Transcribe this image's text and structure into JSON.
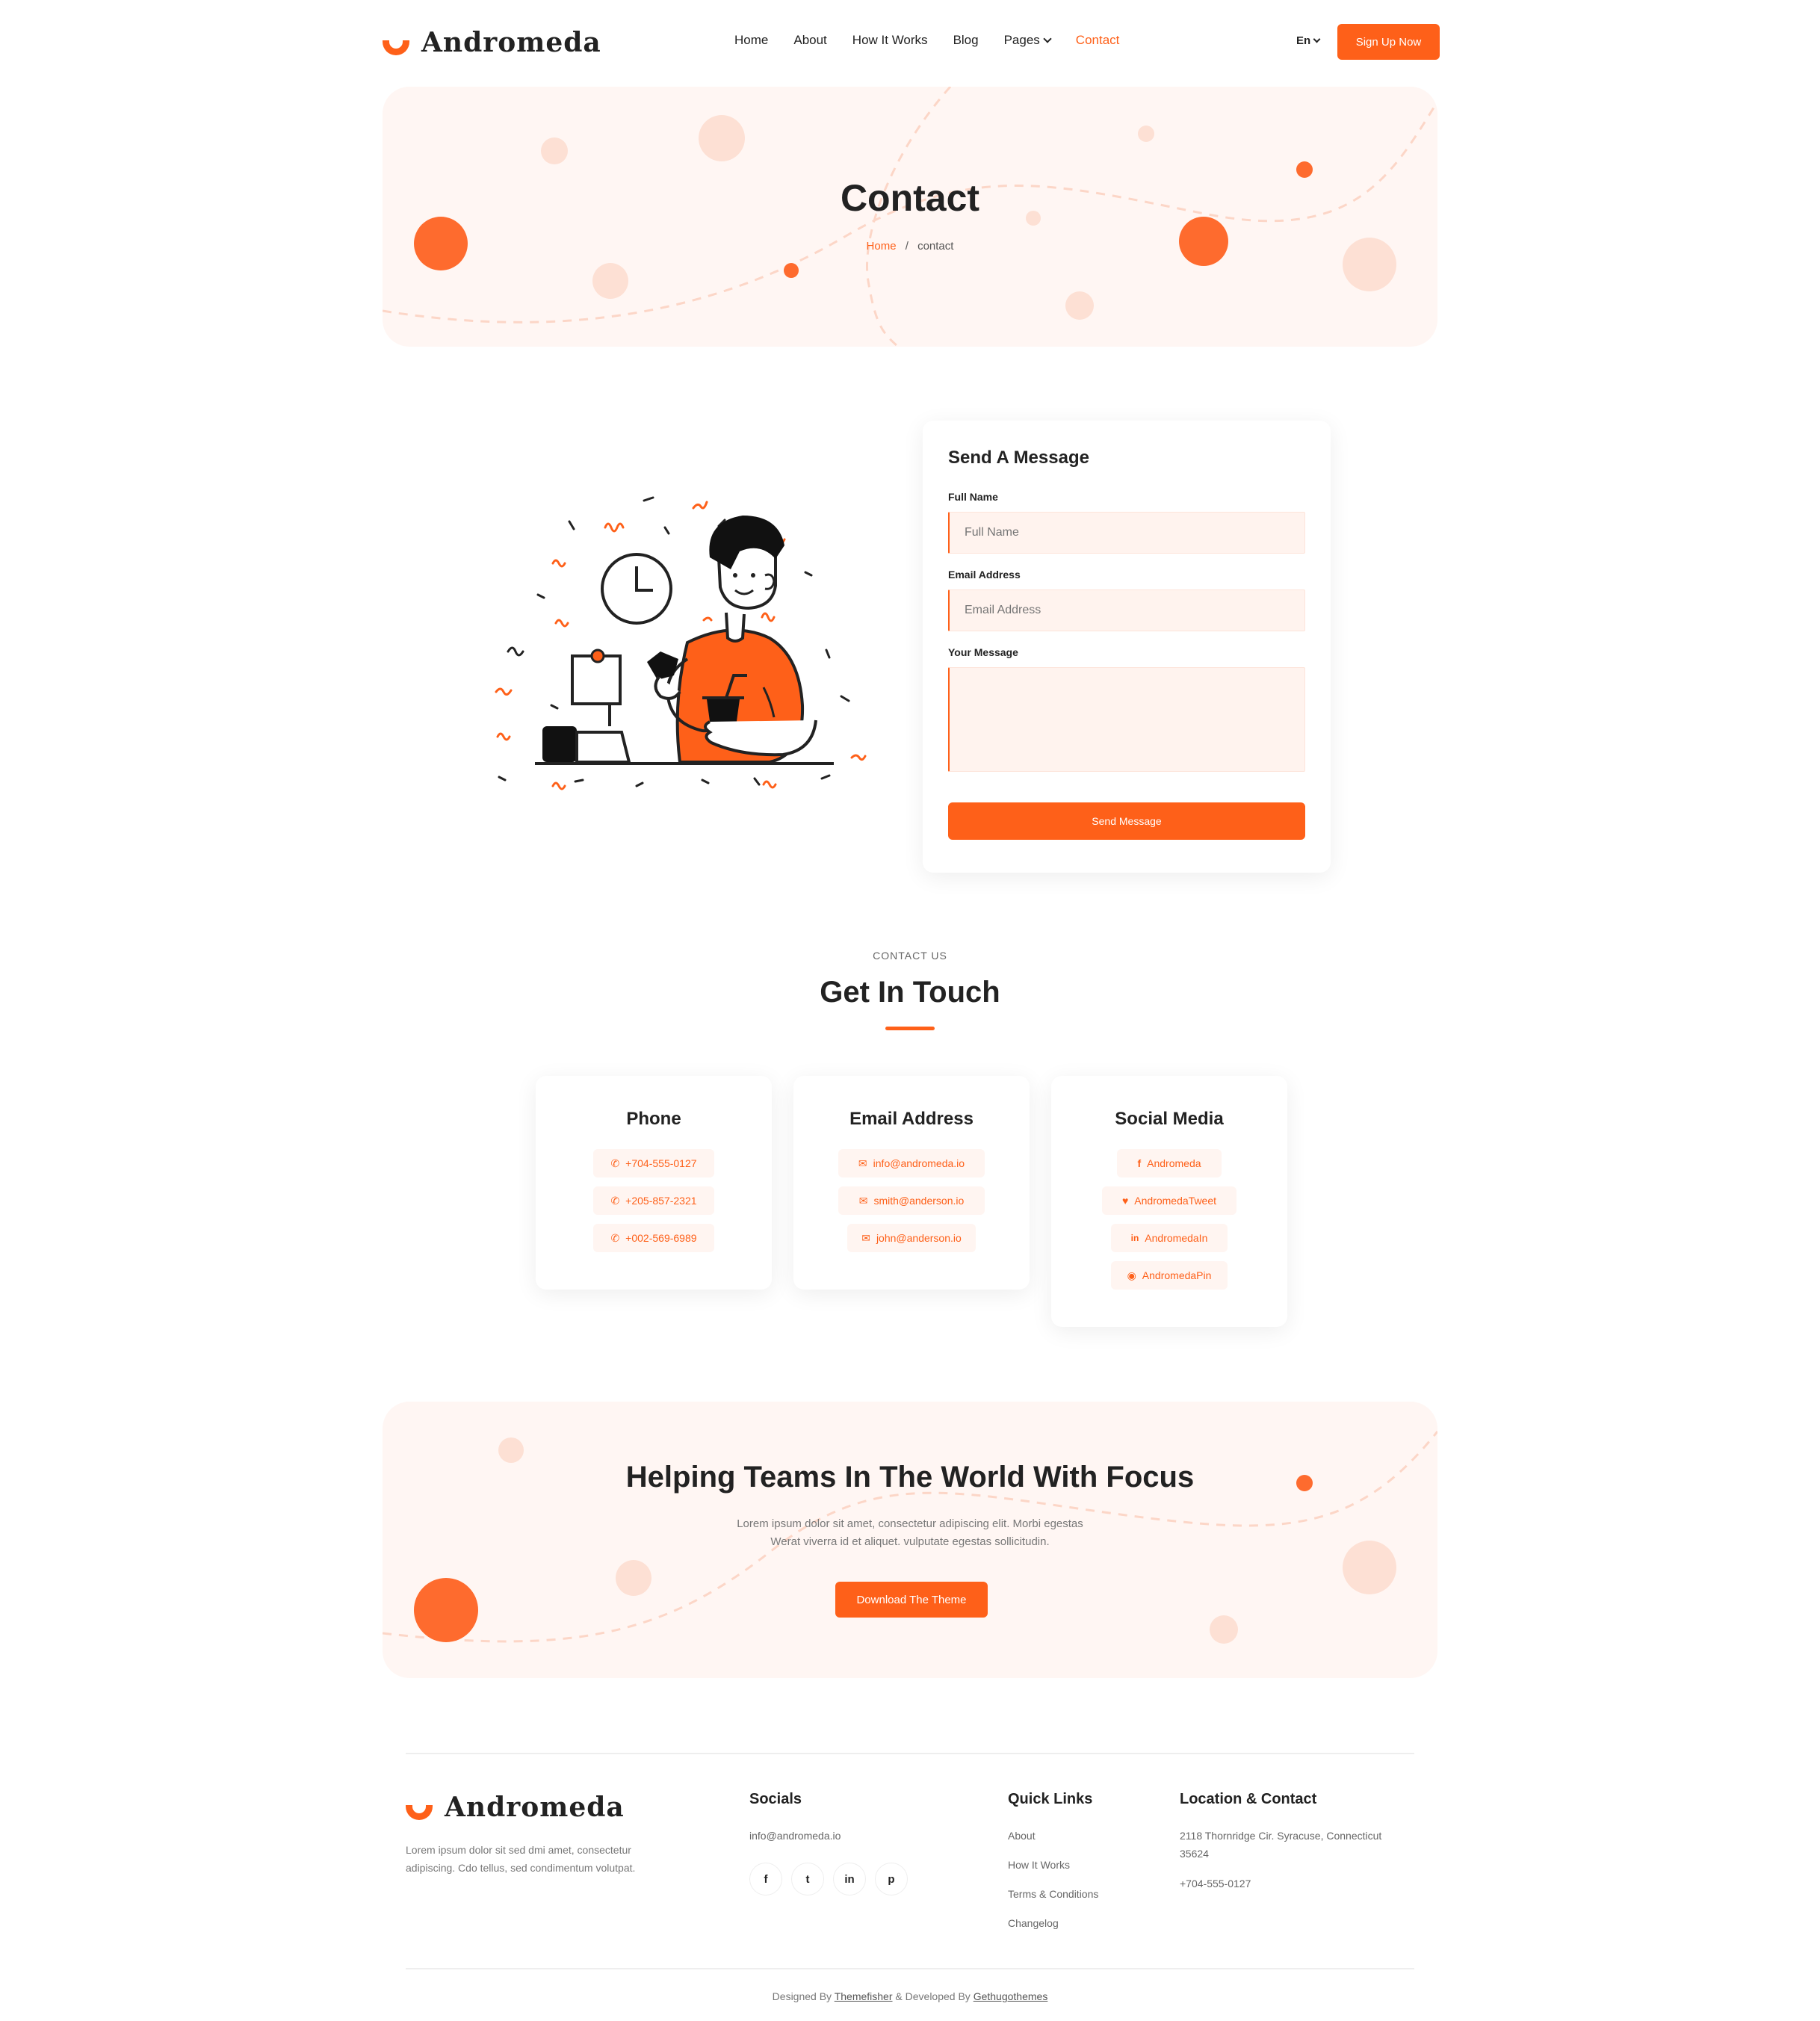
{
  "brand": {
    "name": "Andromeda",
    "accent": "#fe6019",
    "light": "#fff6f3"
  },
  "nav": {
    "items": [
      {
        "label": "Home"
      },
      {
        "label": "About"
      },
      {
        "label": "How It Works"
      },
      {
        "label": "Blog"
      },
      {
        "label": "Pages"
      },
      {
        "label": "Contact"
      }
    ],
    "lang": "En",
    "cta": "Sign Up Now"
  },
  "hero": {
    "title": "Contact",
    "crumb_home": "Home",
    "crumb_sep": "/",
    "crumb_current": "contact"
  },
  "form": {
    "title": "Send A Message",
    "name_label": "Full Name",
    "name_placeholder": "Full Name",
    "email_label": "Email Address",
    "email_placeholder": "Email Address",
    "message_label": "Your Message",
    "submit": "Send Message"
  },
  "contact": {
    "eyebrow": "CONTACT US",
    "title": "Get In Touch",
    "phone": {
      "title": "Phone",
      "items": [
        "+704-555-0127",
        "+205-857-2321",
        "+002-569-6989"
      ]
    },
    "email": {
      "title": "Email Address",
      "items": [
        "info@andromeda.io",
        "smith@anderson.io",
        "john@anderson.io"
      ]
    },
    "social": {
      "title": "Social Media",
      "items": [
        "Andromeda",
        "AndromedaTweet",
        "AndromedaIn",
        "AndromedaPin"
      ]
    }
  },
  "cta_banner": {
    "title": "Helping Teams In The World With Focus",
    "line1": "Lorem ipsum dolor sit amet, consectetur adipiscing elit. Morbi egestas",
    "line2": "Werat viverra id et aliquet. vulputate egestas sollicitudin.",
    "button": "Download The Theme"
  },
  "footer": {
    "about1": "Lorem ipsum dolor sit sed dmi amet, consectetur",
    "about2": "adipiscing. Cdo tellus, sed condimentum volutpat.",
    "socials_title": "Socials",
    "socials_email": "info@andromeda.io",
    "social_icons": [
      "f",
      "t",
      "in",
      "p"
    ],
    "quick_title": "Quick Links",
    "quick_links": [
      "About",
      "How It Works",
      "Terms & Conditions",
      "Changelog"
    ],
    "loc_title": "Location & Contact",
    "address1": "2118 Thornridge Cir. Syracuse, Connecticut",
    "address2": "35624",
    "phone": "+704-555-0127",
    "credit_pre": "Designed By",
    "credit_a": "Themefisher",
    "credit_mid": "& Developed By",
    "credit_b": "Gethugothemes"
  }
}
